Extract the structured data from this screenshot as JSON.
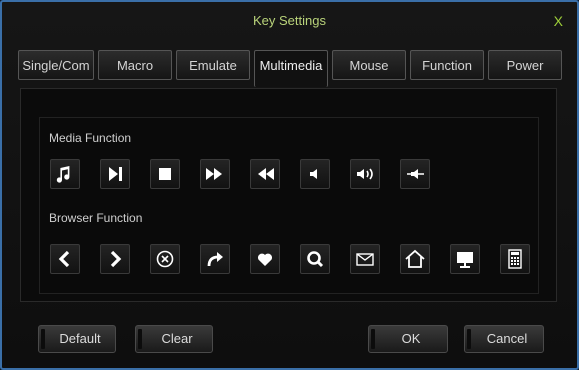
{
  "window": {
    "title": "Key Settings",
    "close_label": "X"
  },
  "tabs": [
    {
      "label": "Single/Com"
    },
    {
      "label": "Macro"
    },
    {
      "label": "Emulate"
    },
    {
      "label": "Multimedia"
    },
    {
      "label": "Mouse"
    },
    {
      "label": "Function"
    },
    {
      "label": "Power"
    }
  ],
  "active_tab": "Multimedia",
  "media": {
    "label": "Media Function",
    "icons": [
      "music-note-icon",
      "play-pause-icon",
      "stop-icon",
      "fast-forward-icon",
      "rewind-icon",
      "volume-down-icon",
      "volume-up-icon",
      "mute-icon"
    ]
  },
  "browser": {
    "label": "Browser Function",
    "icons": [
      "back-icon",
      "forward-icon",
      "stop-circle-icon",
      "refresh-icon",
      "favorites-icon",
      "search-icon",
      "mail-icon",
      "home-icon",
      "computer-icon",
      "calculator-icon"
    ]
  },
  "buttons": {
    "default": "Default",
    "clear": "Clear",
    "ok": "OK",
    "cancel": "Cancel"
  },
  "colors": {
    "title": "#b9d37a",
    "close": "#9fd03a",
    "border": "#3a6fa8"
  }
}
